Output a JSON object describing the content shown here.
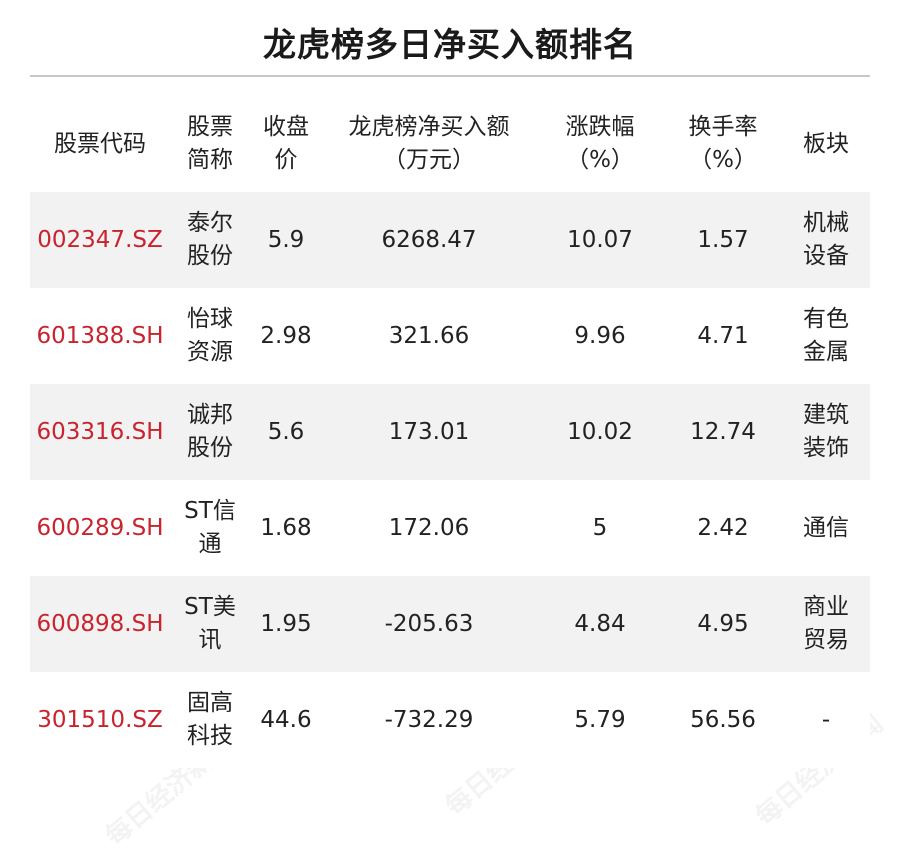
{
  "title": "龙虎榜多日净买入额排名",
  "watermark_text": "每日经济新闻",
  "headers": {
    "code": "股票代码",
    "name": "股票简称",
    "close": "收盘价",
    "net_buy": "龙虎榜净买入额（万元）",
    "change": "涨跌幅（%）",
    "turnover": "换手率（%）",
    "sector": "板块"
  },
  "colors": {
    "code_text": "#c8242e",
    "row_shade": "#f2f2f2",
    "rule": "#c8c8c8"
  },
  "rows": [
    {
      "code": "002347.SZ",
      "name": "泰尔股份",
      "close": "5.9",
      "net_buy": "6268.47",
      "change": "10.07",
      "turnover": "1.57",
      "sector": "机械设备"
    },
    {
      "code": "601388.SH",
      "name": "怡球资源",
      "close": "2.98",
      "net_buy": "321.66",
      "change": "9.96",
      "turnover": "4.71",
      "sector": "有色金属"
    },
    {
      "code": "603316.SH",
      "name": "诚邦股份",
      "close": "5.6",
      "net_buy": "173.01",
      "change": "10.02",
      "turnover": "12.74",
      "sector": "建筑装饰"
    },
    {
      "code": "600289.SH",
      "name": "ST信通",
      "close": "1.68",
      "net_buy": "172.06",
      "change": "5",
      "turnover": "2.42",
      "sector": "通信"
    },
    {
      "code": "600898.SH",
      "name": "ST美讯",
      "close": "1.95",
      "net_buy": "-205.63",
      "change": "4.84",
      "turnover": "4.95",
      "sector": "商业贸易"
    },
    {
      "code": "301510.SZ",
      "name": "固高科技",
      "close": "44.6",
      "net_buy": "-732.29",
      "change": "5.79",
      "turnover": "56.56",
      "sector": "-"
    }
  ]
}
